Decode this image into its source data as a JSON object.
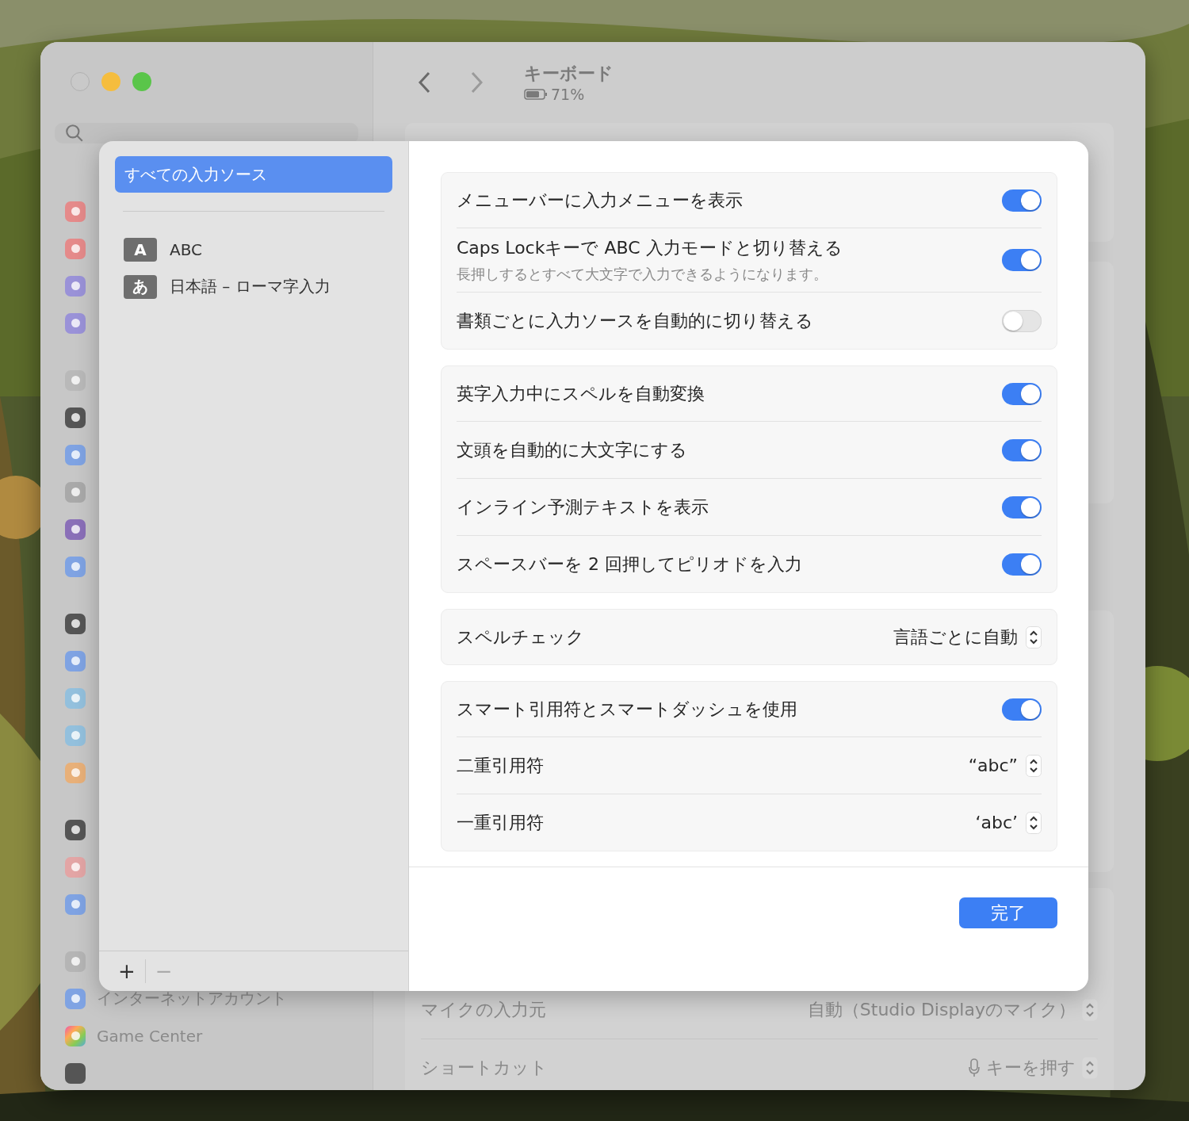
{
  "window": {
    "title": "キーボード",
    "battery": "71%"
  },
  "sidebar": {
    "items": [
      {
        "label": "インターネットアカウント"
      },
      {
        "label": "Game Center"
      }
    ]
  },
  "main_rows": [
    {
      "kind": "plain",
      "label": "マイクの入力元",
      "value": "自動（Studio Displayのマイク）"
    },
    {
      "kind": "mic",
      "label": "ショートカット",
      "value": "キーを押す"
    }
  ],
  "sheet": {
    "sources": {
      "header": {
        "label": "すべての入力ソース",
        "selected": true
      },
      "items": [
        {
          "badge": "A",
          "label": "ABC",
          "selected": false
        },
        {
          "badge": "あ",
          "label": "日本語 – ローマ字入力",
          "selected": false
        }
      ]
    },
    "add": {
      "label": "+",
      "disabled": false
    },
    "remove": {
      "label": "−",
      "disabled": true
    },
    "groups": [
      [
        {
          "kind": "toggle",
          "label": "メニューバーに入力メニューを表示",
          "on": true
        },
        {
          "kind": "toggle",
          "label": "Caps Lockキーで ABC 入力モードと切り替える",
          "note": "長押しするとすべて大文字で入力できるようになります。",
          "on": true
        },
        {
          "kind": "toggle",
          "label": "書類ごとに入力ソースを自動的に切り替える",
          "on": false
        }
      ],
      [
        {
          "kind": "toggle",
          "label": "英字入力中にスペルを自動変換",
          "on": true
        },
        {
          "kind": "toggle",
          "label": "文頭を自動的に大文字にする",
          "on": true
        },
        {
          "kind": "toggle",
          "label": "インライン予測テキストを表示",
          "on": true
        },
        {
          "kind": "toggle",
          "label": "スペースバーを 2 回押してピリオドを入力",
          "on": true
        }
      ],
      [
        {
          "kind": "popup",
          "label": "スペルチェック",
          "value": "言語ごとに自動"
        }
      ],
      [
        {
          "kind": "toggle",
          "label": "スマート引用符とスマートダッシュを使用",
          "on": true
        },
        {
          "kind": "popup",
          "label": "二重引用符",
          "value": "“abc”"
        },
        {
          "kind": "popup",
          "label": "一重引用符",
          "value": "‘abc’"
        }
      ]
    ],
    "done": "完了"
  }
}
